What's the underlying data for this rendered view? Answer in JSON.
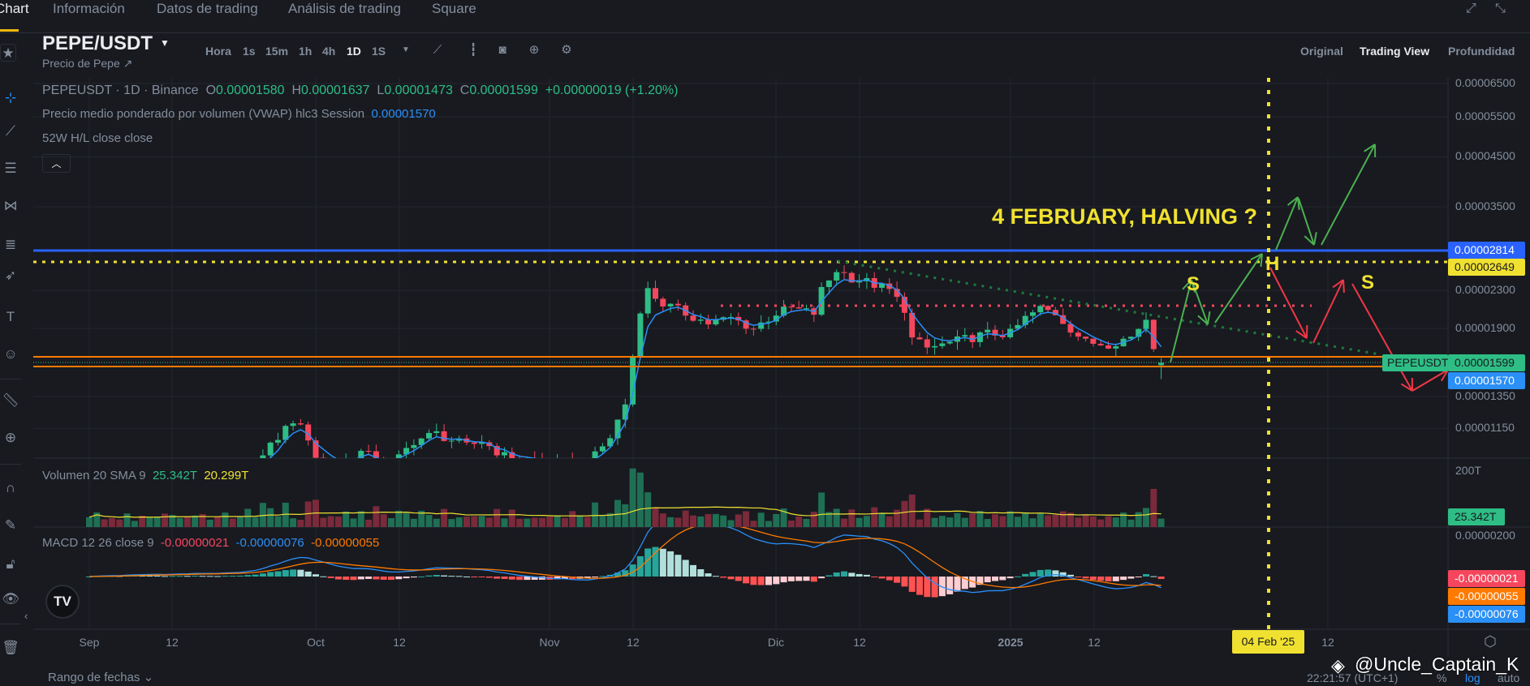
{
  "nav": {
    "tabs": [
      "Chart",
      "Información",
      "Datos de trading",
      "Análisis de trading",
      "Square"
    ],
    "active": "Chart"
  },
  "header": {
    "symbol": "PEPE/USDT",
    "subtitle": "Precio de Pepe ↗",
    "timeframes": [
      "Hora",
      "1s",
      "15m",
      "1h",
      "4h",
      "1D",
      "1S"
    ],
    "active_timeframe": "1D",
    "views": [
      "Original",
      "Trading View",
      "Profundidad"
    ],
    "active_view": "Trading View"
  },
  "legend": {
    "title": "PEPEUSDT · 1D · Binance",
    "o_label": "O",
    "o": "0.00001580",
    "h_label": "H",
    "h": "0.00001637",
    "l_label": "L",
    "l": "0.00001473",
    "c_label": "C",
    "c": "0.00001599",
    "change": "+0.00000019 (+1.20%)",
    "vwap_label": "Precio medio ponderado por volumen (VWAP) hlc3 Session",
    "vwap_value": "0.00001570",
    "hl_label": "52W H/L close close",
    "volume_label": "Volumen 20 SMA 9",
    "volume_value": "25.342T",
    "volume_sma": "20.299T",
    "macd_label": "MACD 12 26 close 9",
    "macd_hist": "-0.00000021",
    "macd_line": "-0.00000076",
    "macd_signal": "-0.00000055"
  },
  "price_axis": {
    "labels": [
      "0.00006500",
      "0.00005500",
      "0.00004500",
      "0.00003500",
      "0.00002300",
      "0.00001900",
      "0.00001350",
      "0.00001150"
    ],
    "tag_blue": "0.00002814",
    "tag_yellow": "0.00002649",
    "symbol_tag": "PEPEUSDT",
    "last_price": "0.00001599",
    "vwap_tag": "0.00001570",
    "volume_axis": "200T",
    "volume_tag": "25.342T",
    "macd_axis": "0.00000200",
    "macd_hist_tag": "-0.00000021",
    "macd_signal_tag": "-0.00000055",
    "macd_line_tag": "-0.00000076"
  },
  "time_axis": {
    "labels": [
      "Sep",
      "12",
      "Oct",
      "12",
      "Nov",
      "12",
      "Dic",
      "12",
      "2025",
      "12",
      "12"
    ],
    "marker": "04 Feb '25"
  },
  "annotations": {
    "headline": "4 FEBRUARY, HALVING ?",
    "left_shoulder": "S",
    "head": "H",
    "right_shoulder": "S"
  },
  "footer": {
    "date_range": "Rango de fechas",
    "clock": "22:21:57 (UTC+1)",
    "percent": "%",
    "log": "log",
    "auto": "auto",
    "watermark": "@Uncle_Captain_K"
  },
  "colors": {
    "up": "#2ebd85",
    "down": "#f6465d",
    "accent": "#f0b90b",
    "blue_line": "#2962ff",
    "vwap": "#2a8ff7"
  },
  "chart_data": {
    "type": "candlestick",
    "title": "PEPEUSDT · 1D · Binance",
    "x_start": "2024-09-01",
    "x_unit": "day",
    "scale": "log",
    "close_keyframes": [
      [
        0,
        7.8e-06
      ],
      [
        20,
        8.5e-06
      ],
      [
        22,
        9.5e-06
      ],
      [
        25,
        1.1e-05
      ],
      [
        27,
        1.2e-05
      ],
      [
        29,
        1.1e-05
      ],
      [
        30,
        1e-05
      ],
      [
        33,
        9.5e-06
      ],
      [
        36,
        1.02e-05
      ],
      [
        40,
        9.5e-06
      ],
      [
        43,
        1.08e-05
      ],
      [
        46,
        1.12e-05
      ],
      [
        50,
        1.05e-05
      ],
      [
        52,
        1.08e-05
      ],
      [
        55,
        1e-05
      ],
      [
        60,
        9.7e-06
      ],
      [
        65,
        9.5e-06
      ],
      [
        67,
        1e-05
      ],
      [
        69,
        1.1e-05
      ],
      [
        71,
        1.3e-05
      ],
      [
        72,
        1.65e-05
      ],
      [
        73,
        2.1e-05
      ],
      [
        74,
        2.3e-05
      ],
      [
        76,
        2.15e-05
      ],
      [
        79,
        2.05e-05
      ],
      [
        82,
        1.95e-05
      ],
      [
        85,
        2e-05
      ],
      [
        88,
        1.9e-05
      ],
      [
        91,
        2.05e-05
      ],
      [
        93,
        2.1e-05
      ],
      [
        96,
        2.05e-05
      ],
      [
        97,
        2.3e-05
      ],
      [
        99,
        2.55e-05
      ],
      [
        101,
        2.45e-05
      ],
      [
        103,
        2.4e-05
      ],
      [
        106,
        2.3e-05
      ],
      [
        108,
        2.1e-05
      ],
      [
        109,
        1.8e-05
      ],
      [
        111,
        1.72e-05
      ],
      [
        113,
        1.75e-05
      ],
      [
        116,
        1.8e-05
      ],
      [
        119,
        1.85e-05
      ],
      [
        122,
        1.85e-05
      ],
      [
        124,
        2e-05
      ],
      [
        126,
        2.1e-05
      ],
      [
        128,
        2.05e-05
      ],
      [
        130,
        1.9e-05
      ],
      [
        132,
        1.77e-05
      ],
      [
        135,
        1.76e-05
      ],
      [
        138,
        1.82e-05
      ],
      [
        140,
        2e-05
      ],
      [
        141,
        1.75e-05
      ],
      [
        142,
        1.6e-05
      ]
    ],
    "last": {
      "open": 1.58e-05,
      "high": 1.637e-05,
      "low": 1.473e-05,
      "close": 1.599e-05
    },
    "levels": {
      "blue": 2.814e-05,
      "yellow_dotted": 2.649e-05,
      "orange_upper": 1.63e-05,
      "orange_lower": 1.56e-05,
      "red_dotted": 2.13e-05
    },
    "halving_date": "2025-02-04"
  }
}
